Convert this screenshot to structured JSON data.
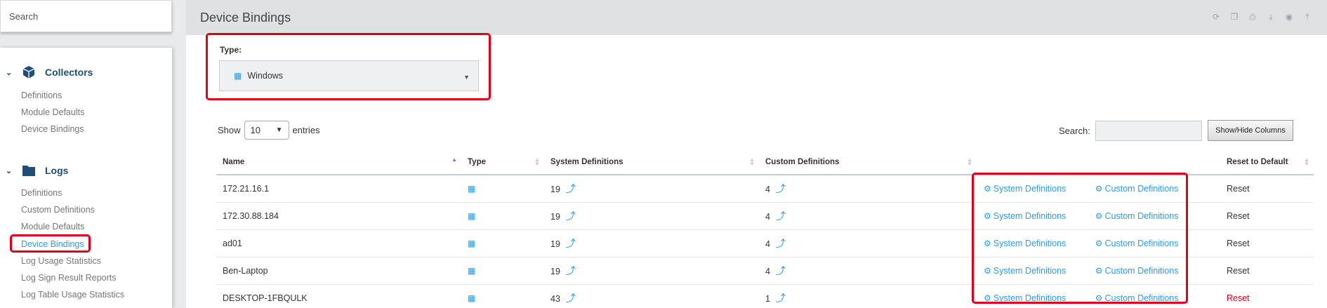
{
  "sidebar": {
    "search_placeholder": "Search",
    "sections": [
      {
        "title": "Collectors",
        "items": [
          "Definitions",
          "Module Defaults",
          "Device Bindings"
        ]
      },
      {
        "title": "Logs",
        "items": [
          "Definitions",
          "Custom Definitions",
          "Module Defaults",
          "Device Bindings",
          "Log Usage Statistics",
          "Log Sign Result Reports",
          "Log Table Usage Statistics"
        ]
      }
    ],
    "active_item": "Device Bindings"
  },
  "header": {
    "title": "Device Bindings",
    "toolbar_icons": [
      "refresh-icon",
      "copy-icon",
      "print-icon",
      "download-icon",
      "toggle-icon",
      "pin-icon"
    ]
  },
  "filter": {
    "type_label": "Type:",
    "type_value": "Windows"
  },
  "table_controls": {
    "show_label": "Show",
    "entries_value": "10",
    "entries_label": "entries",
    "search_label": "Search:",
    "showhide_label": "Show/Hide Columns"
  },
  "table": {
    "headers": [
      "Name",
      "Type",
      "System Definitions",
      "Custom Definitions",
      "",
      "Reset to Default"
    ],
    "rows": [
      {
        "name": "172.21.16.1",
        "system": "19",
        "custom": "4",
        "sys_link": "System Definitions",
        "cust_link": "Custom Definitions",
        "reset": "Reset",
        "reset_color": "#333333"
      },
      {
        "name": "172.30.88.184",
        "system": "19",
        "custom": "4",
        "sys_link": "System Definitions",
        "cust_link": "Custom Definitions",
        "reset": "Reset",
        "reset_color": "#333333"
      },
      {
        "name": "ad01",
        "system": "19",
        "custom": "4",
        "sys_link": "System Definitions",
        "cust_link": "Custom Definitions",
        "reset": "Reset",
        "reset_color": "#333333"
      },
      {
        "name": "Ben-Laptop",
        "system": "19",
        "custom": "4",
        "sys_link": "System Definitions",
        "cust_link": "Custom Definitions",
        "reset": "Reset",
        "reset_color": "#333333"
      },
      {
        "name": "DESKTOP-1FBQULK",
        "system": "43",
        "custom": "1",
        "sys_link": "System Definitions",
        "cust_link": "Custom Definitions",
        "reset": "Reset",
        "reset_color": "#e0001a"
      }
    ]
  },
  "colors": {
    "accent": "#2a9df4",
    "highlight": "#e0001a",
    "nav_heading": "#1b4f7a"
  }
}
